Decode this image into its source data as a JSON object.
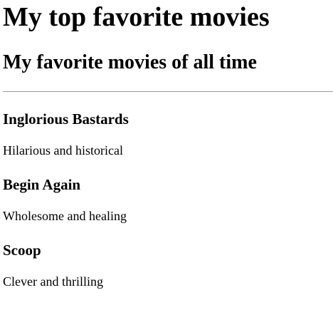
{
  "page": {
    "title": "My top favorite movies",
    "subtitle": "My favorite movies of all time"
  },
  "movies": [
    {
      "title": "Inglorious Bastards",
      "description": "Hilarious and historical"
    },
    {
      "title": "Begin Again",
      "description": "Wholesome and healing"
    },
    {
      "title": "Scoop",
      "description": "Clever and thrilling"
    }
  ]
}
